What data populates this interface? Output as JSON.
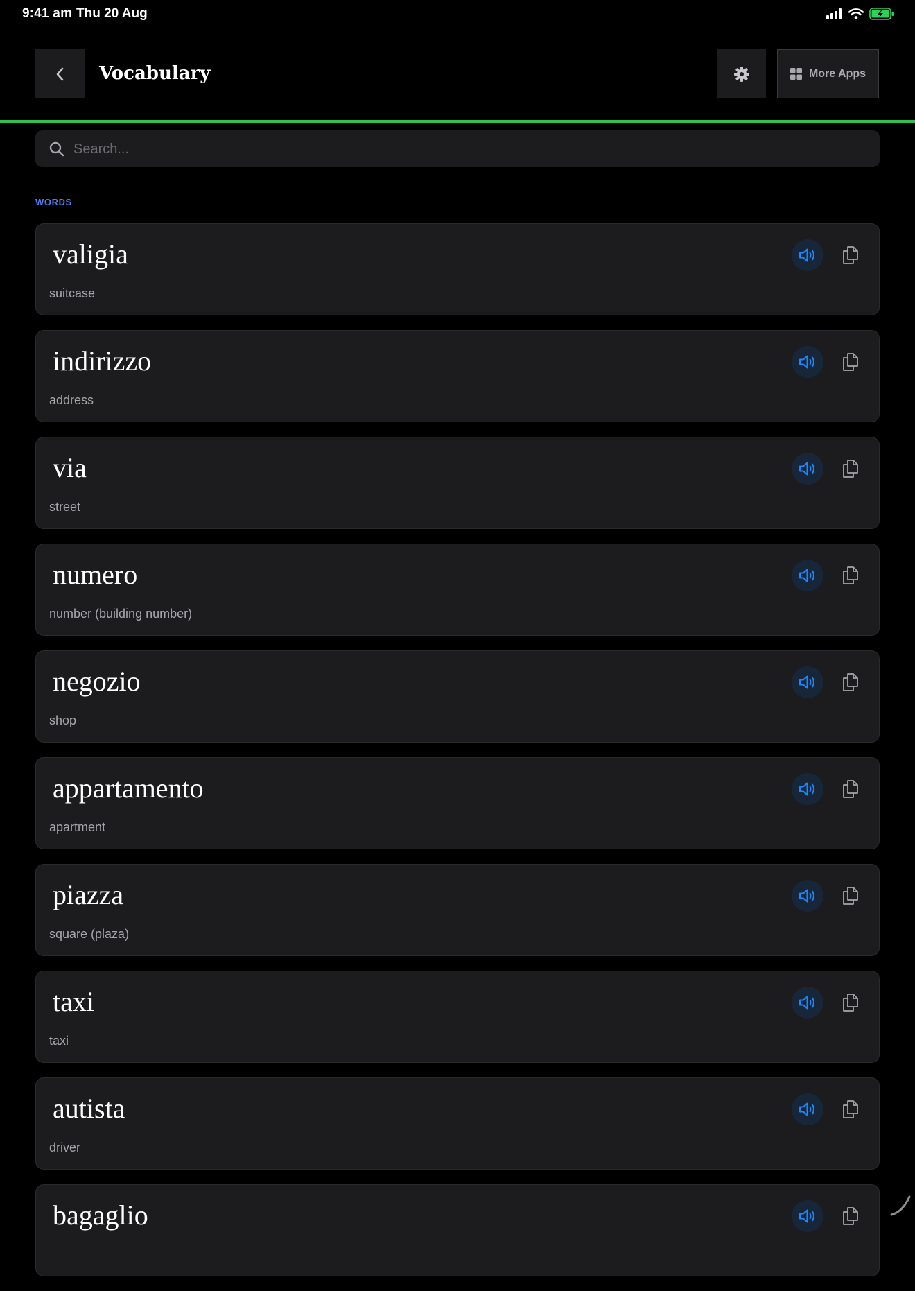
{
  "status_bar": {
    "time": "9:41 am",
    "date": "Thu 20 Aug"
  },
  "header": {
    "title": "Vocabulary",
    "more_apps_label": "More Apps"
  },
  "search": {
    "placeholder": "Search..."
  },
  "section": {
    "label": "WORDS"
  },
  "colors": {
    "accent_line": "#30c04f",
    "section_label": "#4f7ff0",
    "speak_icon": "#1a88ff",
    "battery": "#30d158"
  },
  "icons": {
    "back": "chevron-left-icon",
    "settings": "gear-icon",
    "more_apps": "grid-icon",
    "search": "search-icon",
    "speak": "speaker-icon",
    "copy": "copy-icon"
  },
  "words": [
    {
      "term": "valigia",
      "translation": "suitcase"
    },
    {
      "term": "indirizzo",
      "translation": "address"
    },
    {
      "term": "via",
      "translation": "street"
    },
    {
      "term": "numero",
      "translation": "number (building number)"
    },
    {
      "term": "negozio",
      "translation": "shop"
    },
    {
      "term": "appartamento",
      "translation": "apartment"
    },
    {
      "term": "piazza",
      "translation": "square (plaza)"
    },
    {
      "term": "taxi",
      "translation": "taxi"
    },
    {
      "term": "autista",
      "translation": "driver"
    },
    {
      "term": "bagaglio",
      "translation": ""
    }
  ]
}
